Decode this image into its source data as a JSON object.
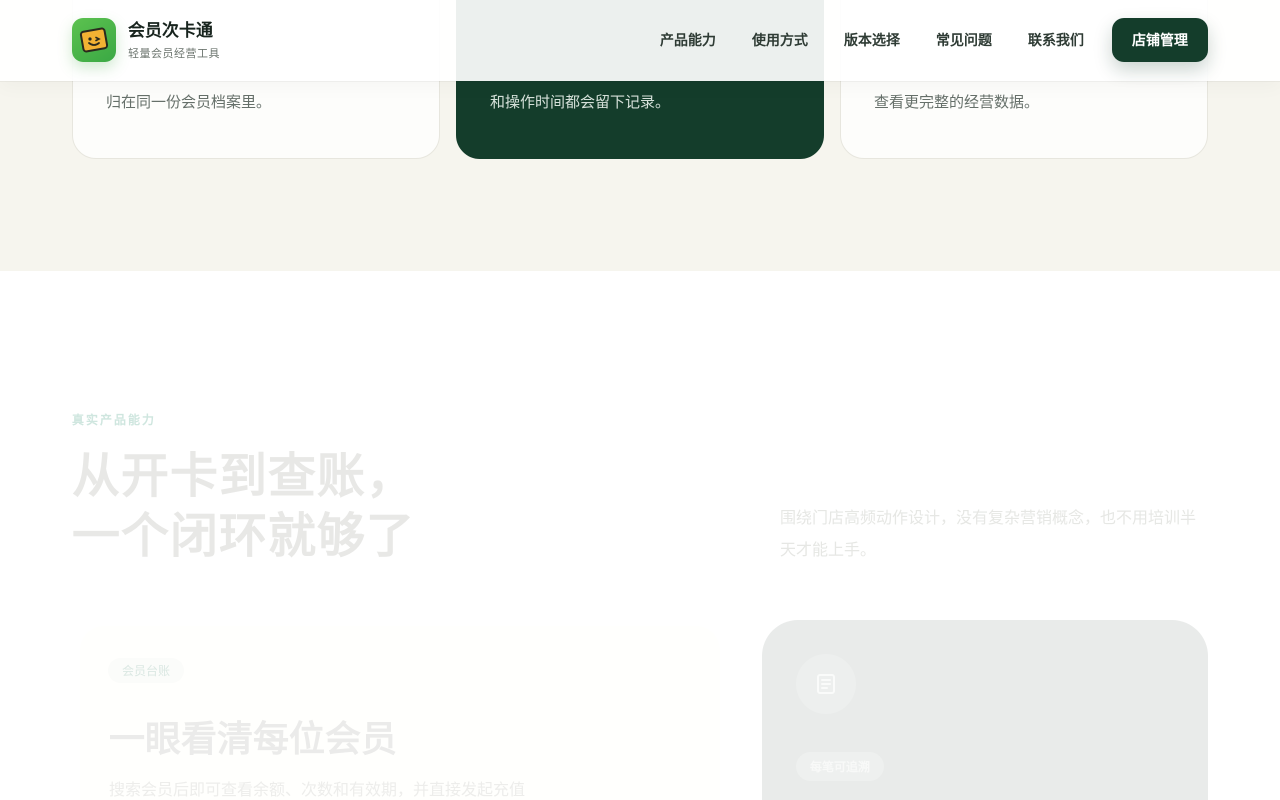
{
  "brand": {
    "name": "会员次卡通",
    "subtitle": "轻量会员经营工具",
    "logo_icon": "wallet-smile-icon"
  },
  "nav": {
    "items": [
      "产品能力",
      "使用方式",
      "版本选择",
      "常见问题",
      "联系我们"
    ],
    "cta": "店铺管理"
  },
  "feature_cards": [
    {
      "text": "归在同一份会员档案里。"
    },
    {
      "text": "和操作时间都会留下记录。"
    },
    {
      "text": "查看更完整的经营数据。"
    }
  ],
  "section": {
    "eyebrow": "真实产品能力",
    "headline_line1": "从开卡到查账，",
    "headline_line2": "一个闭环就够了",
    "intro": "围绕门店高频动作设计，没有复杂营销概念，也不用培训半天才能上手。"
  },
  "member_card": {
    "tag": "会员台账",
    "title": "一眼看清每位会员",
    "desc": "搜索会员后即可查看余额、次数和有效期，并直接发起充值"
  },
  "record_card": {
    "icon": "document-icon",
    "tag": "每笔可追溯"
  },
  "colors": {
    "brand_dark": "#143d2b",
    "logo_green": "#4cb64a",
    "band_bg": "#f6f5ee"
  }
}
